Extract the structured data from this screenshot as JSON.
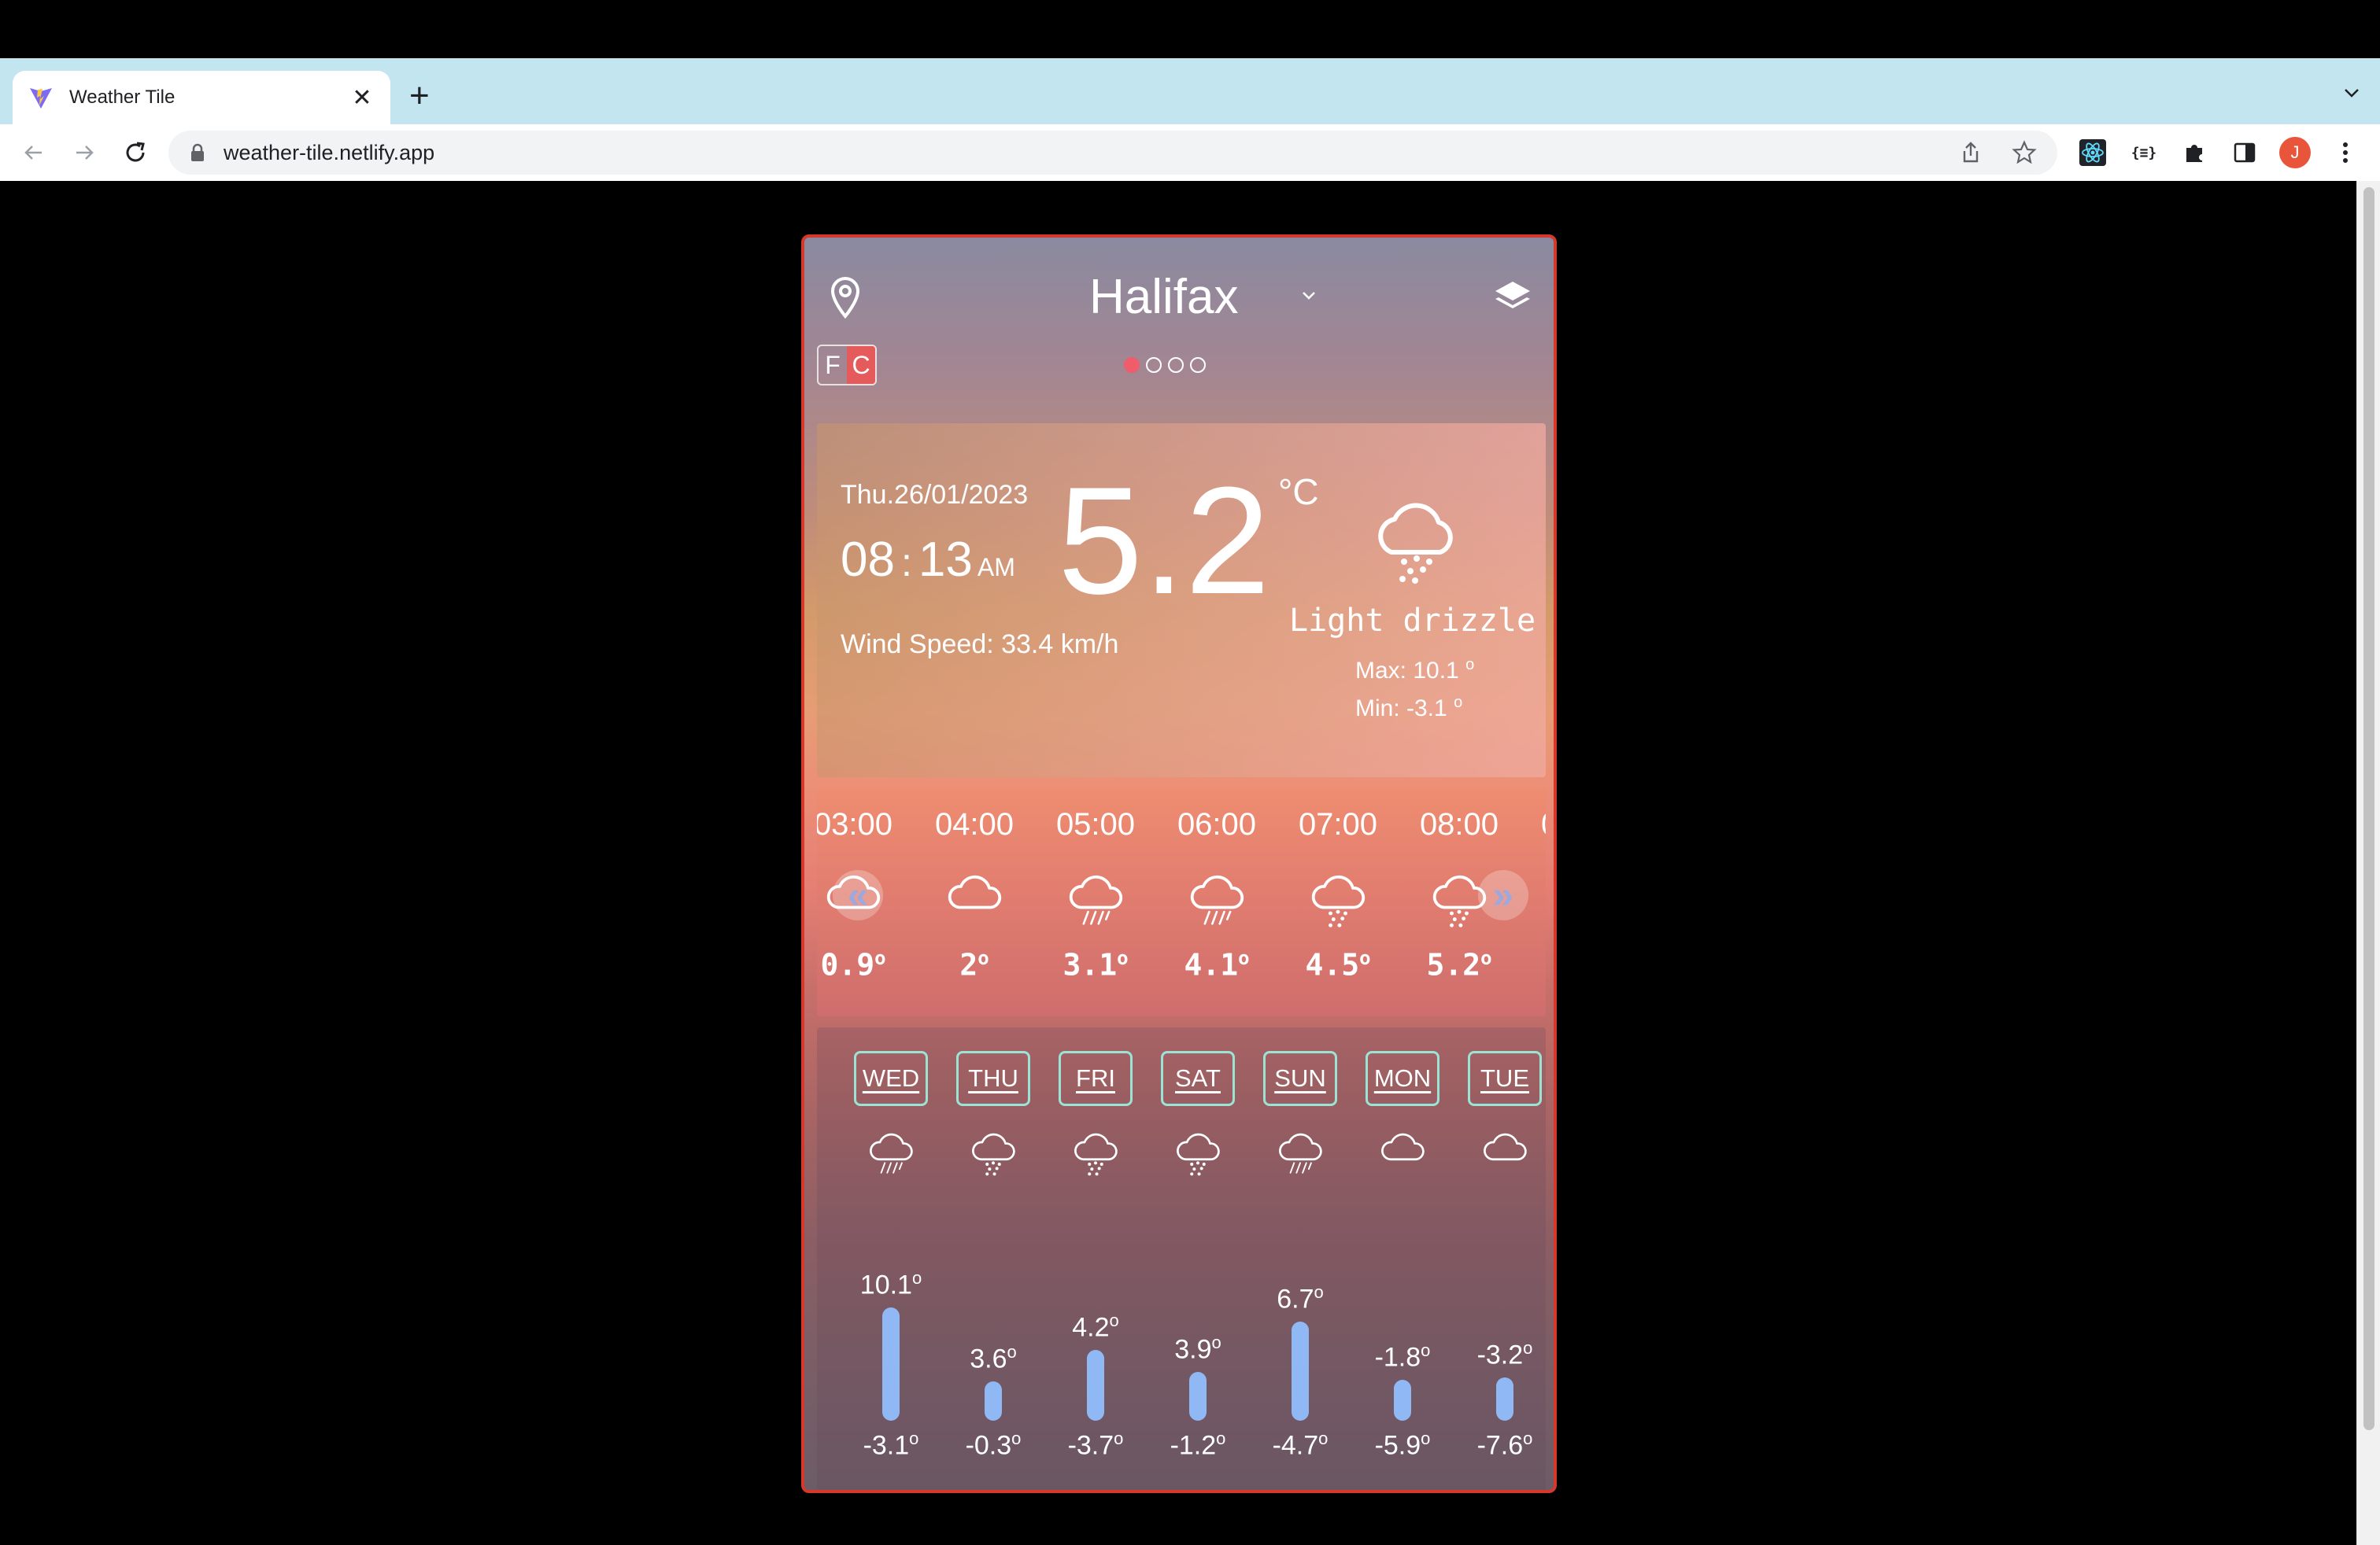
{
  "browser": {
    "tab_title": "Weather Tile",
    "url": "weather-tile.netlify.app",
    "avatar_letter": "J"
  },
  "app": {
    "city": "Halifax",
    "unit_f": "F",
    "unit_c": "C",
    "page_dots": 4,
    "active_dot": 0,
    "current": {
      "date": "Thu.26/01/2023",
      "hour": "08",
      "colon": ":",
      "minute": "13",
      "ampm": "AM",
      "wind": "Wind Speed: 33.4 km/h",
      "temperature": "5.2",
      "unit": "°C",
      "condition": "Light drizzle",
      "max_label": "Max: 10.1",
      "min_label": "Min: -3.1",
      "degree": "o",
      "icon": "drizzle-cloud-icon"
    },
    "hourly": [
      {
        "time": "03:00",
        "temp": "0.9",
        "icon": "cloud-icon"
      },
      {
        "time": "04:00",
        "temp": "2",
        "icon": "cloud-icon"
      },
      {
        "time": "05:00",
        "temp": "3.1",
        "icon": "rain-cloud-icon"
      },
      {
        "time": "06:00",
        "temp": "4.1",
        "icon": "rain-cloud-icon"
      },
      {
        "time": "07:00",
        "temp": "4.5",
        "icon": "drizzle-cloud-icon"
      },
      {
        "time": "08:00",
        "temp": "5.2",
        "icon": "drizzle-cloud-icon"
      }
    ],
    "hourly_prev": "«",
    "hourly_next": "»",
    "daily": [
      {
        "day": "WED",
        "max": 10.1,
        "min": -3.1,
        "max_label": "10.1",
        "min_label": "-3.1",
        "icon": "rain-cloud-icon"
      },
      {
        "day": "THU",
        "max": 3.6,
        "min": -0.3,
        "max_label": "3.6",
        "min_label": "-0.3",
        "icon": "snow-cloud-icon"
      },
      {
        "day": "FRI",
        "max": 4.2,
        "min": -3.7,
        "max_label": "4.2",
        "min_label": "-3.7",
        "icon": "snow-cloud-icon"
      },
      {
        "day": "SAT",
        "max": 3.9,
        "min": -1.2,
        "max_label": "3.9",
        "min_label": "-1.2",
        "icon": "drizzle-cloud-icon"
      },
      {
        "day": "SUN",
        "max": 6.7,
        "min": -4.7,
        "max_label": "6.7",
        "min_label": "-4.7",
        "icon": "rain-cloud-icon"
      },
      {
        "day": "MON",
        "max": -1.8,
        "min": -5.9,
        "max_label": "-1.8",
        "min_label": "-5.9",
        "icon": "cloud-icon"
      },
      {
        "day": "TUE",
        "max": -3.2,
        "min": -7.6,
        "max_label": "-3.2",
        "min_label": "-7.6",
        "icon": "cloud-icon"
      }
    ]
  },
  "colors": {
    "accent_red": "#e55a5a",
    "bar_blue": "#8fb8f5",
    "day_border": "#9be3d4"
  }
}
